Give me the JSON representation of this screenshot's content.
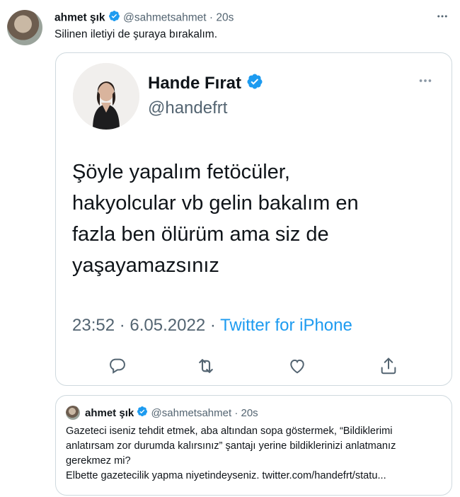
{
  "outer_tweet": {
    "author_name": "ahmet şık",
    "author_handle": "@sahmetsahmet",
    "separator": "·",
    "time": "20s",
    "text": "Silinen iletiyi de şuraya bırakalım.",
    "more_icon": "more-dots-icon"
  },
  "embedded_tweet": {
    "author_name": "Hande Fırat",
    "author_handle": "@handefrt",
    "body_lines": [
      "Şöyle yapalım fetöcüler,",
      "hakyolcular vb gelin bakalım  en",
      "fazla ben ölürüm ama siz de",
      "yaşayamazsınız"
    ],
    "time": "23:52",
    "separator": "·",
    "date": "6.05.2022",
    "source_separator": "·",
    "source": "Twitter for iPhone",
    "actions": [
      "reply-icon",
      "retweet-icon",
      "like-icon",
      "share-icon"
    ]
  },
  "quoted_tweet": {
    "author_name": "ahmet şık",
    "author_handle": "@sahmetsahmet",
    "separator": "·",
    "time": "20s",
    "lines": [
      "Gazeteci iseniz tehdit etmek, aba altından sopa göstermek, “Bildiklerimi",
      "anlatırsam zor durumda kalırsınız” şantajı yerine bildiklerinizi anlatmanız",
      "gerekmez mi?",
      "Elbette gazetecilik yapma niyetindeyseniz. twitter.com/handefrt/statu..."
    ]
  },
  "colors": {
    "text_primary": "#0f1419",
    "text_secondary": "#536471",
    "accent": "#1d9bf0",
    "border": "#cfd9de"
  }
}
